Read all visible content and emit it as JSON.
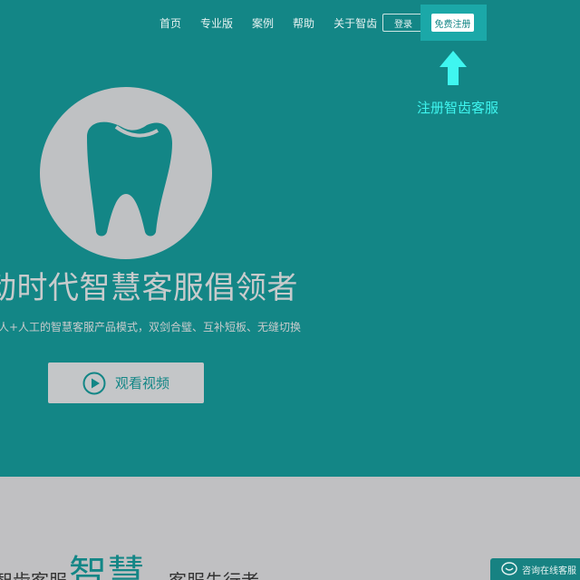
{
  "nav": {
    "items": [
      "首页",
      "专业版",
      "案例",
      "帮助",
      "关于智齿"
    ],
    "login_label": "登录",
    "register_label": "免费注册"
  },
  "annotation": {
    "text": "注册智齿客服",
    "color": "#3ff6f0"
  },
  "hero": {
    "headline": "动时代智慧客服倡领者",
    "subhead": "人+人工的智慧客服产品模式，双剑合璧、互补短板、无缝切换",
    "video_label": "观看视频",
    "background": "#138686"
  },
  "section2": {
    "text_left": "智齿客服",
    "text_highlight": "智慧",
    "text_right": "客服先行者"
  },
  "chat_float": {
    "label": "咨询在线客服"
  },
  "icons": {
    "logo": "tooth-icon",
    "video": "play-icon",
    "chat": "chat-bubble-icon",
    "pointer": "arrow-up-icon"
  }
}
